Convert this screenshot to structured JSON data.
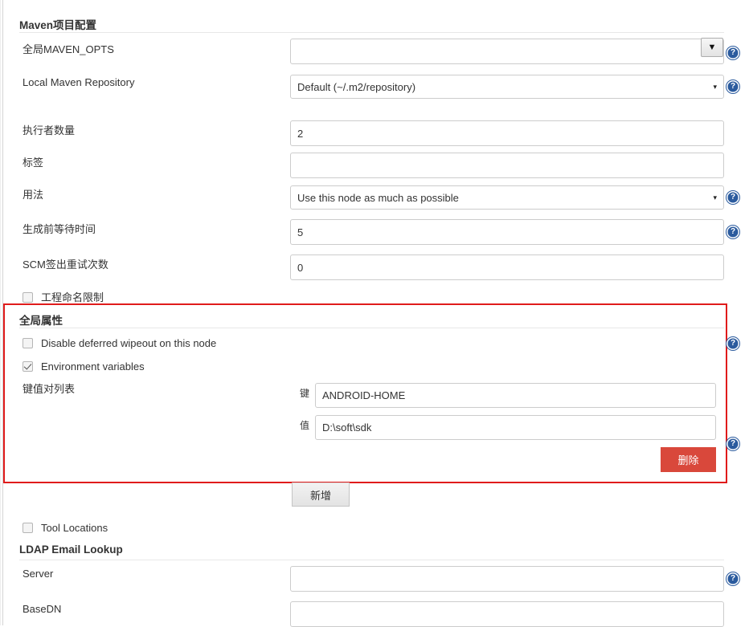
{
  "sections": {
    "maven": {
      "title": "Maven项目配置",
      "rows": [
        {
          "label": "全局MAVEN_OPTS",
          "value": "",
          "type": "combo",
          "help": true
        },
        {
          "label": "Local Maven Repository",
          "value": "Default (~/.m2/repository)",
          "type": "select",
          "help": true
        },
        {
          "label": "执行者数量",
          "value": "2",
          "type": "text",
          "help": false
        },
        {
          "label": "标签",
          "value": "",
          "type": "text",
          "help": false
        },
        {
          "label": "用法",
          "value": "Use this node as much as possible",
          "type": "select",
          "help": true
        },
        {
          "label": "生成前等待时间",
          "value": "5",
          "type": "text",
          "help": true
        },
        {
          "label": "SCM签出重试次数",
          "value": "0",
          "type": "text",
          "help": false
        }
      ],
      "project_naming_checkbox": {
        "label": "工程命名限制",
        "checked": false
      }
    },
    "global_properties": {
      "title": "全局属性",
      "disable_wipeout": {
        "label": "Disable deferred wipeout on this node",
        "checked": false
      },
      "environment_variables": {
        "label": "Environment variables",
        "checked": true
      },
      "kv_list_label": "键值对列表",
      "key_label": "键",
      "key_value": "ANDROID-HOME",
      "value_label": "值",
      "value_value": "D:\\soft\\sdk",
      "delete_button": "删除",
      "highlight_color": "#e01b1b"
    },
    "add_button": "新增",
    "tool_locations": {
      "label": "Tool Locations",
      "checked": false
    },
    "ldap": {
      "title": "LDAP Email Lookup",
      "rows": [
        {
          "label": "Server",
          "value": "",
          "help": true
        },
        {
          "label": "BaseDN",
          "value": "",
          "help": false
        }
      ]
    }
  },
  "icons": {
    "help": "?",
    "caret_down": "▼",
    "caret_small": "▾"
  }
}
